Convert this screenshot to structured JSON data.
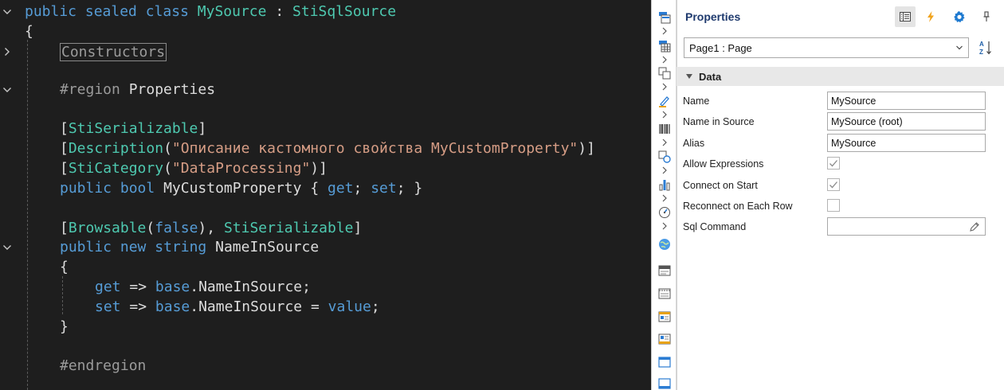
{
  "editor": {
    "lines": {
      "l0": {
        "public": "public",
        "sealed": "sealed",
        "class": "class",
        "name": "MySource",
        "colon": ":",
        "base": "StiSqlSource"
      },
      "l1": {
        "brace": "{"
      },
      "l2": {
        "collapsed": "Constructors"
      },
      "l3": {
        "region": "#region",
        "label": "Properties"
      },
      "l4": {
        "open": "[",
        "attr": "StiSerializable",
        "close": "]"
      },
      "l5": {
        "open": "[",
        "attr": "Description",
        "paren_open": "(",
        "str": "\"Описание кастомного свойства MyCustomProperty\"",
        "paren_close": ")]"
      },
      "l6": {
        "open": "[",
        "attr": "StiCategory",
        "paren_open": "(",
        "str": "\"DataProcessing\"",
        "paren_close": ")]"
      },
      "l7": {
        "public": "public",
        "bool": "bool",
        "name": "MyCustomProperty",
        "ob": "{",
        "get": "get",
        "semi1": ";",
        "set": "set",
        "semi2": ";",
        "cb": "}"
      },
      "l8": {
        "open": "[",
        "attr1": "Browsable",
        "paren_open": "(",
        "false": "false",
        "paren_close": "),",
        "attr2": "StiSerializable",
        "close": "]"
      },
      "l9": {
        "public": "public",
        "new": "new",
        "string": "string",
        "name": "NameInSource"
      },
      "l10": {
        "brace": "{"
      },
      "l11": {
        "get": "get",
        "arrow": "=>",
        "base": "base",
        "dot": ".",
        "member": "NameInSource",
        "semi": ";"
      },
      "l12": {
        "set": "set",
        "arrow": "=>",
        "base": "base",
        "dot": ".",
        "member": "NameInSource",
        "eq": "=",
        "value": "value",
        "semi": ";"
      },
      "l13": {
        "brace": "}"
      },
      "l14": {
        "endregion": "#endregion"
      }
    }
  },
  "properties": {
    "title": "Properties",
    "header_icons": [
      "property-grid-icon",
      "lightning-icon",
      "gear-icon",
      "pin-icon"
    ],
    "selected_object": "Page1 : Page",
    "category": "Data",
    "rows": [
      {
        "name": "Name",
        "value": "MySource",
        "kind": "text"
      },
      {
        "name": "Name in Source",
        "value": "MySource (root)",
        "kind": "text"
      },
      {
        "name": "Alias",
        "value": "MySource",
        "kind": "text"
      },
      {
        "name": "Allow Expressions",
        "checked": true,
        "kind": "check"
      },
      {
        "name": "Connect on Start",
        "checked": true,
        "kind": "check"
      },
      {
        "name": "Reconnect on Each Row",
        "checked": false,
        "kind": "check"
      },
      {
        "name": "Sql Command",
        "value": "",
        "kind": "edit"
      }
    ]
  },
  "colors": {
    "keyword": "#569cd6",
    "type": "#4ec9b0",
    "string": "#d69d85",
    "accent": "#2b7cd3"
  }
}
